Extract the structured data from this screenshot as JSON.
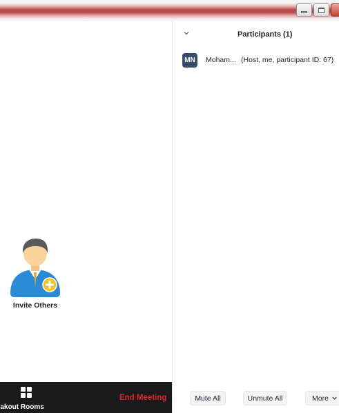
{
  "window": {
    "controls": [
      "minimize",
      "maximize",
      "close"
    ]
  },
  "left": {
    "invite_label": "Invite Others",
    "toolbar": {
      "breakout_label": "reakout Rooms",
      "breakout_icon": "grid-icon",
      "end_meeting_label": "End Meeting"
    }
  },
  "participants_panel": {
    "title": "Participants (1)",
    "items": [
      {
        "initials": "MN",
        "name": "Moham...",
        "role": "(Host, me, participant ID: 67)",
        "avatar_color": "#374b6a"
      }
    ],
    "footer": {
      "mute_all": "Mute All",
      "unmute_all": "Unmute All",
      "more": "More"
    }
  },
  "colors": {
    "end_meeting": "#e0232b",
    "toolbar_bg": "#1a1a1a",
    "invite_badge": "#f6c21c",
    "invite_body": "#2b8ad6"
  }
}
